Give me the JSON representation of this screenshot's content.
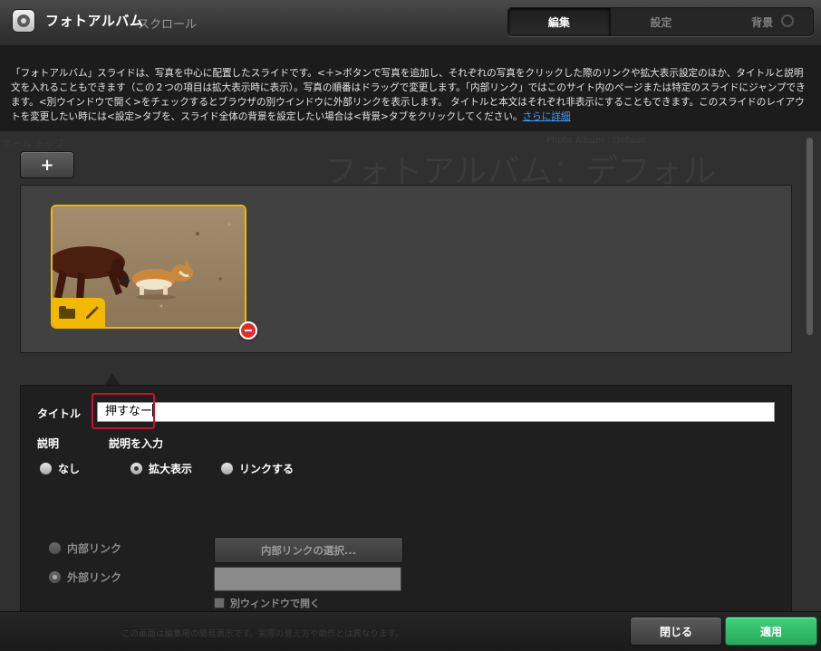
{
  "window": {
    "title": "フォトアルバム",
    "ghost_tab_text": "スクロール"
  },
  "tabs": [
    {
      "label": "編集",
      "active": true
    },
    {
      "label": "設定",
      "active": false
    },
    {
      "label": "背景",
      "active": false
    }
  ],
  "help": {
    "text": "「フォトアルバム」スライドは、写真を中心に配置したスライドです。<＋>ボタンで写真を追加し、それぞれの写真をクリックした際のリンクや拡大表示設定のほか、タイトルと説明文を入れることもできます（この２つの項目は拡大表示時に表示）。写真の順番はドラッグで変更します。「内部リンク」ではこのサイト内のページまたは特定のスライドにジャンプできます。<別ウインドウで開く>をチェックするとブラウザの別ウインドウに外部リンクを表示します。 タイトルと本文はそれぞれ非表示にすることもできます。このスライドのレイアウトを変更したい時には<設定>タブを、スライド全体の背景を設定したい場合は<背景>タブをクリックしてください。",
    "link": "さらに詳細"
  },
  "ghost_background": {
    "big_title": "フォトアルバム：デフォル",
    "small_text": "Photo Album : Default",
    "left_text": "ホーム トップ"
  },
  "toolbar": {
    "add_label": "+"
  },
  "detail": {
    "title_label": "タイトル",
    "title_value": "押すなー",
    "description_label": "説明",
    "description_placeholder": "説明を入力",
    "click_options": [
      {
        "label": "なし",
        "checked": false
      },
      {
        "label": "拡大表示",
        "checked": true
      },
      {
        "label": "リンクする",
        "checked": false
      }
    ],
    "internal_link_label": "内部リンク",
    "external_link_label": "外部リンク",
    "internal_link_button": "内部リンクの選択...",
    "external_url_value": "",
    "new_window_label": "別ウィンドウで開く"
  },
  "footer": {
    "ghost_text": "この画面は編集用の簡易表示です。実際の見え方や動作とは異なります。",
    "close_label": "閉じる",
    "apply_label": "適用"
  },
  "colors": {
    "accent_yellow": "#f2b900",
    "apply_green": "#2fbd68",
    "remove_red": "#e12d2d",
    "highlight_red": "#c8102e",
    "link_blue": "#3aa0ff"
  }
}
